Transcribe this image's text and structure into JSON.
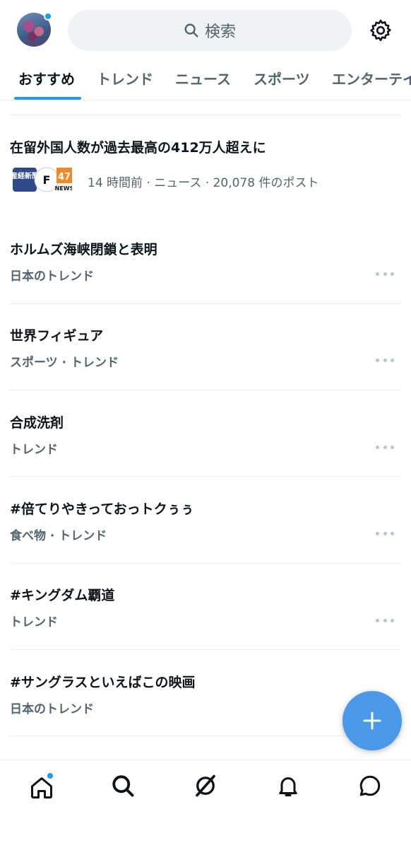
{
  "header": {
    "search_label": "検索",
    "avatar_has_badge": true,
    "accent_color": "#1d9bf0"
  },
  "tabs": [
    {
      "label": "おすすめ",
      "active": true
    },
    {
      "label": "トレンド",
      "active": false
    },
    {
      "label": "ニュース",
      "active": false
    },
    {
      "label": "スポーツ",
      "active": false
    },
    {
      "label": "エンターテイ",
      "active": false
    }
  ],
  "news": {
    "title": "在留外国人数が過去最高の412万人超えに",
    "meta": "14 時間前 · ニュース · 20,078 件のポスト",
    "source_icons": [
      "newspaper-logo-icon",
      "f-logo-icon",
      "47news-logo-icon"
    ],
    "source_icon_text": {
      "sankei": "産経新聞",
      "f": "F",
      "n47": "47",
      "news": "NEWS"
    }
  },
  "trends": [
    {
      "title": "ホルムズ海峡閉鎖と表明",
      "meta": "日本のトレンド",
      "has_more": true
    },
    {
      "title": "世界フィギュア",
      "meta": "スポーツ · トレンド",
      "has_more": true
    },
    {
      "title": "合成洗剤",
      "meta": "トレンド",
      "has_more": true
    },
    {
      "title": "#倍てりやきっておっトクぅぅ",
      "meta": "食べ物 · トレンド",
      "has_more": true
    },
    {
      "title": "#キングダム覇道",
      "meta": "トレンド",
      "has_more": true
    },
    {
      "title": "#サングラスといえばこの映画",
      "meta": "日本のトレンド",
      "has_more": false
    }
  ],
  "fab": {
    "icon": "plus-icon",
    "color": "#4a99e9"
  },
  "bottom_nav": [
    {
      "icon": "home-icon",
      "badge": true
    },
    {
      "icon": "search-icon",
      "badge": false
    },
    {
      "icon": "grok-icon",
      "badge": false
    },
    {
      "icon": "bell-icon",
      "badge": false
    },
    {
      "icon": "chat-bubble-icon",
      "badge": false
    }
  ]
}
